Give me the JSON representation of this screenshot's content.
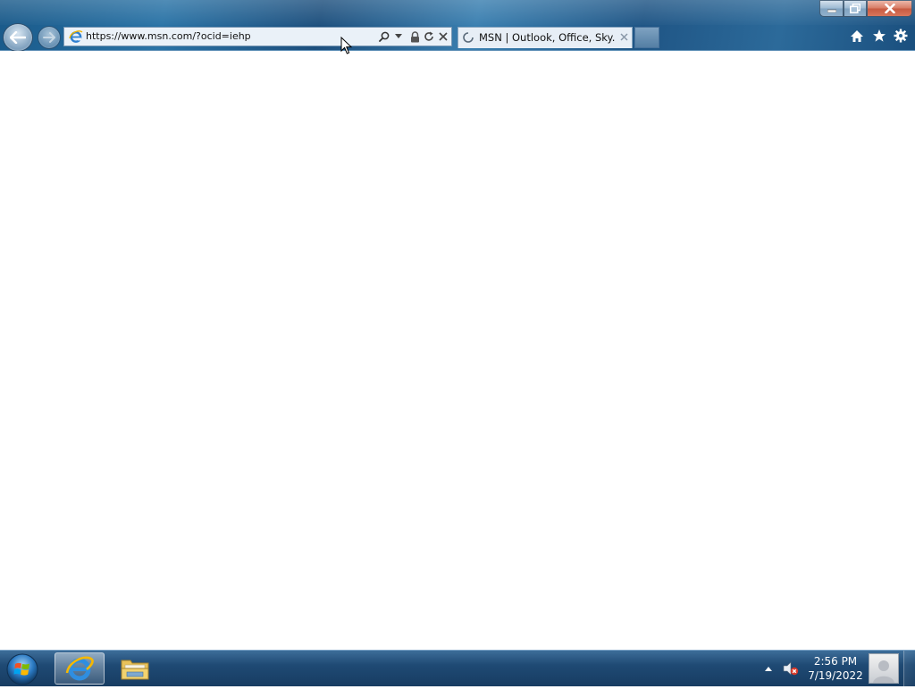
{
  "browser": {
    "address": {
      "url": "https://www.msn.com/?ocid=iehp"
    },
    "tab": {
      "title": "MSN | Outlook, Office, Sky..."
    },
    "window_controls": {
      "minimize": "minimize",
      "maximize": "maximize",
      "close": "close"
    },
    "icons": {
      "back": "back-arrow-icon",
      "forward": "forward-arrow-icon",
      "site": "ie-logo-icon",
      "search": "search-icon",
      "dropdown": "chevron-down-icon",
      "security": "lock-icon",
      "refresh": "refresh-icon",
      "stop": "stop-icon",
      "tab_status": "loading-icon",
      "home": "home-icon",
      "favorites": "star-icon",
      "tools": "gear-icon"
    }
  },
  "taskbar": {
    "pinned": [
      {
        "name": "Internet Explorer",
        "icon": "ie-logo-icon",
        "active": true
      },
      {
        "name": "Windows Explorer",
        "icon": "folder-icon",
        "active": false
      }
    ],
    "clock": {
      "time": "2:56 PM",
      "date": "7/19/2022"
    },
    "tray": {
      "volume": "volume-muted-icon",
      "overflow": "up-arrow-icon"
    }
  },
  "colors": {
    "titlebar": "#1f5585",
    "taskbar": "#1f4a74",
    "close_button": "#c84a2c"
  }
}
